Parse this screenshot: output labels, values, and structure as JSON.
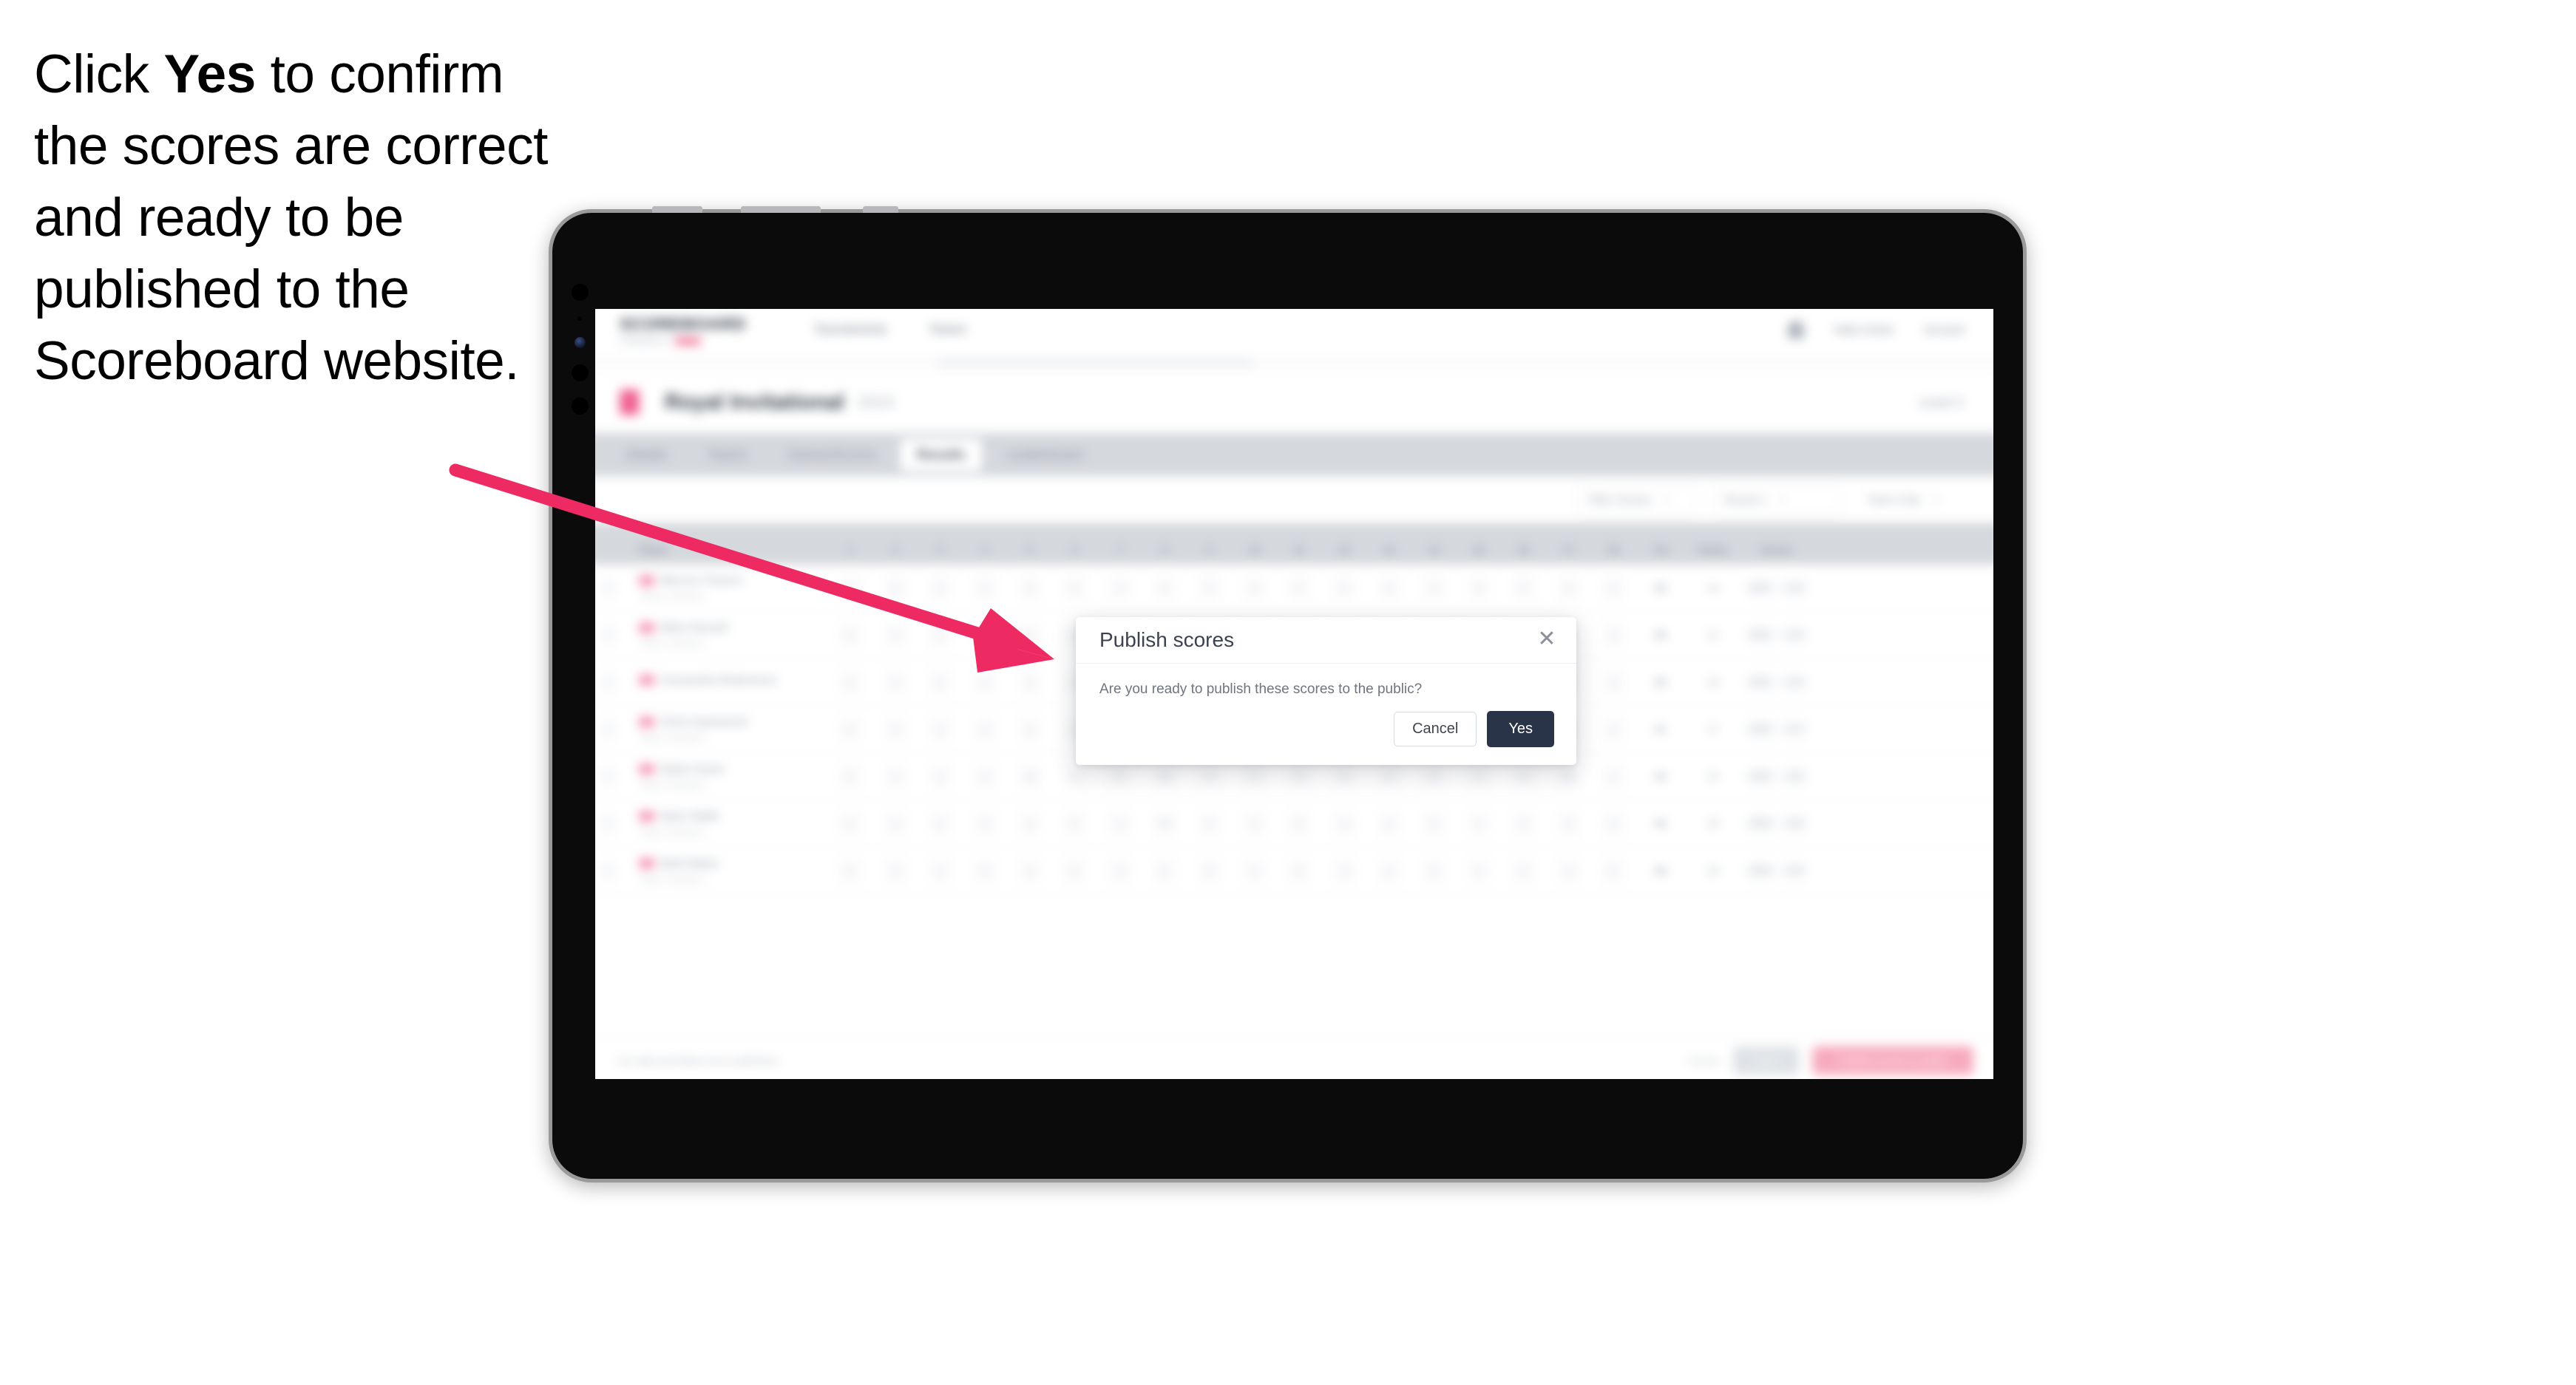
{
  "instruction": {
    "before": "Click ",
    "emphasis": "Yes",
    "after": " to confirm the scores are correct and ready to be published to the Scoreboard website."
  },
  "colors": {
    "accent_pink": "#ee2a62",
    "brand_pink": "#ec4373",
    "modal_primary": "#2a3448",
    "tablet_frame": "#9a9a9c",
    "tablet_body": "#0b0b0c"
  },
  "modal": {
    "title": "Publish scores",
    "close_icon": "close-icon",
    "body": "Are you ready to publish these scores to the public?",
    "cancel_label": "Cancel",
    "confirm_label": "Yes"
  },
  "app": {
    "logo_word": "SCOREBOARD",
    "logo_sub": "POWERED BY",
    "nav": [
      "Tournaments",
      "Teams"
    ],
    "nav_right": [
      "Help Centre",
      "Account"
    ],
    "notification_icon": "bell-icon",
    "title": "Royal Invitational",
    "title_sub": "2024",
    "title_flag_icon": "flag-icon",
    "title_right": "Level 3",
    "tabs": [
      {
        "label": "Details",
        "active": false
      },
      {
        "label": "Teams",
        "active": false
      },
      {
        "label": "Games/Scores",
        "active": false
      },
      {
        "label": "Results",
        "active": true
      },
      {
        "label": "Leaderboard",
        "active": false
      }
    ],
    "filters": [
      {
        "label": "Filter Scores",
        "value": "All",
        "icon": "chevron-down-icon"
      },
      {
        "label": "Round 1",
        "value": "",
        "icon": "chevron-down-icon"
      },
      {
        "label": "Team Only",
        "value": "",
        "icon": "chevron-down-icon"
      }
    ],
    "table": {
      "headers": [
        "",
        "Player",
        "1",
        "2",
        "3",
        "4",
        "5",
        "6",
        "7",
        "8",
        "9",
        "10",
        "11",
        "12",
        "13",
        "14",
        "15",
        "16",
        "17",
        "18",
        "Tot",
        "Points",
        "Scores"
      ],
      "rows": [
        {
          "player": "Marcus Travers",
          "sub": "Team 1 Group A",
          "holes": [
            "4",
            "5",
            "3",
            "4",
            "5",
            "4",
            "3",
            "4",
            "5",
            "4",
            "3",
            "5",
            "4",
            "4",
            "3",
            "5",
            "4",
            "4"
          ],
          "total": "86",
          "points": "34",
          "scores": [
            "GR1",
            "+12"
          ]
        },
        {
          "player": "Ellen Parnell",
          "sub": "Team 1 Group A",
          "holes": [
            "5",
            "4",
            "4",
            "3",
            "5",
            "4",
            "4",
            "5",
            "3",
            "4",
            "4",
            "5",
            "3",
            "5",
            "4",
            "4",
            "5",
            "3"
          ],
          "total": "88",
          "points": "31",
          "scores": [
            "GR1",
            "+14"
          ]
        },
        {
          "player": "Cassandra Robertson",
          "sub": "",
          "holes": [
            "4",
            "4",
            "5",
            "4",
            "3",
            "5",
            "4",
            "4",
            "5",
            "3",
            "4",
            "5",
            "4",
            "3",
            "5",
            "4",
            "4",
            "4"
          ],
          "total": "86",
          "points": "33",
          "scores": [
            "GR1",
            "+12"
          ]
        },
        {
          "player": "Chris Hammond",
          "sub": "Team 2 Group B",
          "holes": [
            "4",
            "5",
            "4",
            "4",
            "3",
            "5",
            "4",
            "10",
            "4",
            "5",
            "3",
            "4",
            "5",
            "4",
            "4",
            "3",
            "5",
            "4"
          ],
          "total": "91",
          "points": "27",
          "scores": [
            "GR2",
            "+17"
          ]
        },
        {
          "player": "Dylan Grant",
          "sub": "Team 2 Group B",
          "holes": [
            "5",
            "4",
            "3",
            "4",
            "10",
            "4",
            "5",
            "10",
            "3",
            "4",
            "5",
            "4",
            "4",
            "5",
            "3",
            "4",
            "12",
            "4"
          ],
          "total": "93",
          "points": "25",
          "scores": [
            "GR2",
            "+19"
          ]
        },
        {
          "player": "Nasir Malik",
          "sub": "Team 3 Group C",
          "holes": [
            "4",
            "4",
            "5",
            "3",
            "4",
            "5",
            "4",
            "10",
            "4",
            "3",
            "5",
            "4",
            "4",
            "5",
            "4",
            "3",
            "5",
            "4"
          ],
          "total": "90",
          "points": "28",
          "scores": [
            "GR3",
            "+16"
          ]
        },
        {
          "player": "Beth Baker",
          "sub": "Team 3 Group C",
          "holes": [
            "5",
            "3",
            "4",
            "5",
            "4",
            "4",
            "3",
            "5",
            "4",
            "4",
            "5",
            "3",
            "4",
            "5",
            "4",
            "4",
            "4",
            "5"
          ],
          "total": "89",
          "points": "30",
          "scores": [
            "GR3",
            "+15"
          ]
        }
      ]
    },
    "bottom": {
      "note": "No edits permitted once published.",
      "link": "Cancel",
      "secondary_label": "Save",
      "primary_label": "Publish scores to public"
    }
  }
}
